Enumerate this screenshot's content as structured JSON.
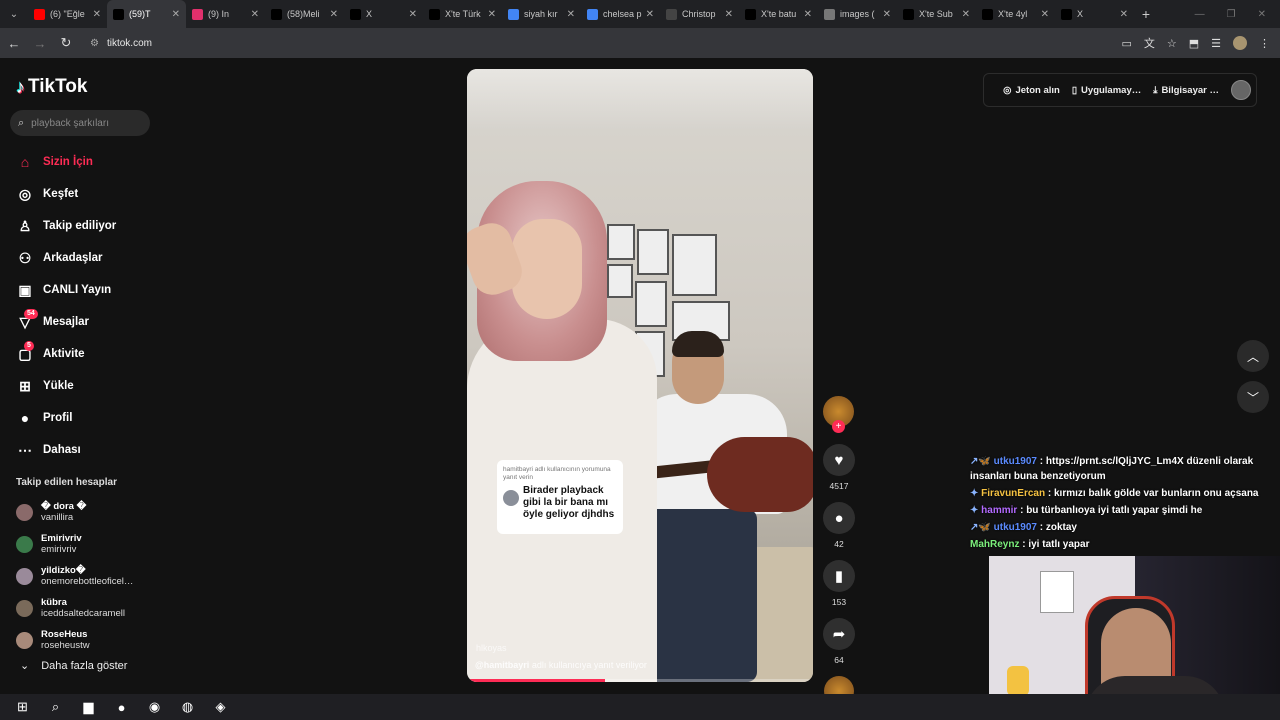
{
  "browser": {
    "tabs": [
      {
        "title": "(6) \"Eğle",
        "color": "#ff0000"
      },
      {
        "title": "(59)T",
        "color": "#000000",
        "active": true
      },
      {
        "title": "(9) In",
        "color": "#e1306c"
      },
      {
        "title": "(58)Meli",
        "color": "#000000"
      },
      {
        "title": "X",
        "color": "#000000"
      },
      {
        "title": "X'te Türk",
        "color": "#000000"
      },
      {
        "title": "siyah kır",
        "color": "#4285f4"
      },
      {
        "title": "chelsea p",
        "color": "#4285f4"
      },
      {
        "title": "Christop",
        "color": "#444444"
      },
      {
        "title": "X'te batu",
        "color": "#000000"
      },
      {
        "title": "images (",
        "color": "#777777"
      },
      {
        "title": "X'te Sub",
        "color": "#000000"
      },
      {
        "title": "X'te 4yl",
        "color": "#000000"
      },
      {
        "title": "X",
        "color": "#000000"
      }
    ],
    "url": "tiktok.com"
  },
  "tiktok": {
    "logo": "TikTok",
    "search_placeholder": "playback şarkıları",
    "nav": [
      {
        "label": "Sizin İçin",
        "icon": "home-icon",
        "glyph": "⌂",
        "active": true
      },
      {
        "label": "Keşfet",
        "icon": "compass-icon",
        "glyph": "◎"
      },
      {
        "label": "Takip ediliyor",
        "icon": "following-icon",
        "glyph": "♙"
      },
      {
        "label": "Arkadaşlar",
        "icon": "friends-icon",
        "glyph": "⚇"
      },
      {
        "label": "CANLI Yayın",
        "icon": "live-icon",
        "glyph": "▣"
      },
      {
        "label": "Mesajlar",
        "icon": "messages-icon",
        "glyph": "▽",
        "badge": "54"
      },
      {
        "label": "Aktivite",
        "icon": "activity-icon",
        "glyph": "▢",
        "badge": "5"
      },
      {
        "label": "Yükle",
        "icon": "upload-icon",
        "glyph": "⊞"
      },
      {
        "label": "Profil",
        "icon": "profile-icon",
        "glyph": "●"
      },
      {
        "label": "Dahası",
        "icon": "more-icon",
        "glyph": "⋯"
      }
    ],
    "following_header": "Takip edilen hesaplar",
    "following": [
      {
        "name": "� dora �",
        "user": "vanillira",
        "color": "#8a6a6a"
      },
      {
        "name": "Emirivriv",
        "user": "emirivriv",
        "color": "#3a7a4a"
      },
      {
        "name": "yildizko�",
        "user": "onemorebottleoficel…",
        "color": "#9a8a9a"
      },
      {
        "name": "kübra",
        "user": "iceddsaltedcaramell",
        "color": "#7a6a5a"
      },
      {
        "name": "RoseHeus",
        "user": "roseheustw",
        "color": "#a88a7a"
      }
    ],
    "show_more": "Daha fazla göster",
    "top_right": {
      "coins": "Jeton alın",
      "app": "Uygulamay…",
      "desktop": "Bilgisayar …"
    }
  },
  "video": {
    "reply_small": "hamitbayri adlı kullanıcının yorumuna yanıt verin",
    "reply_text": "Birader playback gibi la bir bana mı öyle geliyor djhdhs",
    "watermark": "hlkoyas",
    "caption_user": "@hamitbayri",
    "caption_rest": "adlı kullanıcıya yanıt veriliyor",
    "progress": 0.4,
    "likes": "4517",
    "comments": "42",
    "saves": "153",
    "shares": "64"
  },
  "chat": [
    {
      "prefix": "↗🦋",
      "user": "utku1907",
      "cls": "u1",
      "text": "https://prnt.sc/lQljJYC_Lm4X düzenli olarak insanları buna benzetiyorum"
    },
    {
      "prefix": "✦",
      "user": "FiravunErcan",
      "cls": "u2",
      "text": "kırmızı balık gölde var bunların onu açsana"
    },
    {
      "prefix": "✦",
      "user": "hammir",
      "cls": "u3",
      "text": "bu türbanlıoya iyi tatlı yapar şimdi he"
    },
    {
      "prefix": "↗🦋",
      "user": "utku1907",
      "cls": "u1",
      "text": "zoktay"
    },
    {
      "prefix": "",
      "user": "MahReynz",
      "cls": "u4",
      "text": "iyi tatlı yapar"
    }
  ],
  "taskbar": [
    {
      "icon": "windows-icon",
      "glyph": "⊞"
    },
    {
      "icon": "search-icon",
      "glyph": "⌕"
    },
    {
      "icon": "file-explorer-icon",
      "glyph": "▆"
    },
    {
      "icon": "app-icon",
      "glyph": "●"
    },
    {
      "icon": "chrome-icon",
      "glyph": "◉"
    },
    {
      "icon": "obs-icon",
      "glyph": "◍"
    },
    {
      "icon": "messenger-icon",
      "glyph": "◈"
    }
  ]
}
